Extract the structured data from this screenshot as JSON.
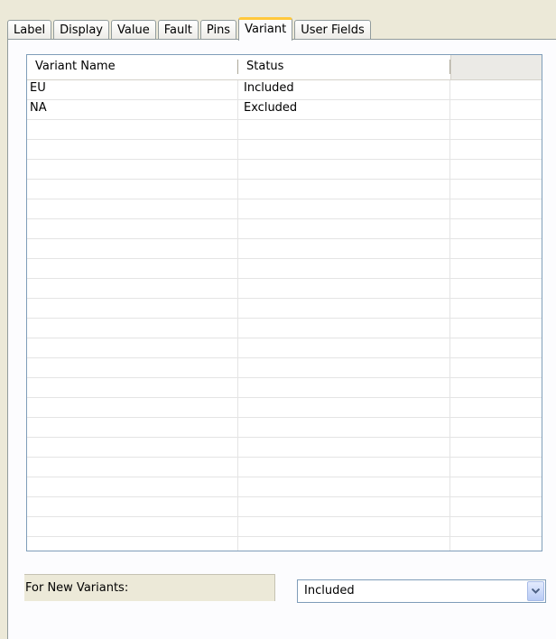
{
  "tabs": [
    {
      "label": "Label",
      "active": false
    },
    {
      "label": "Display",
      "active": false
    },
    {
      "label": "Value",
      "active": false
    },
    {
      "label": "Fault",
      "active": false
    },
    {
      "label": "Pins",
      "active": false
    },
    {
      "label": "Variant",
      "active": true
    },
    {
      "label": "User Fields",
      "active": false
    }
  ],
  "grid": {
    "columns": [
      "Variant Name",
      "Status"
    ],
    "rows": [
      {
        "name": "EU",
        "status": "Included"
      },
      {
        "name": "NA",
        "status": "Excluded"
      }
    ]
  },
  "for_new_variants": {
    "label": "For New Variants:",
    "selected": "Included"
  },
  "icons": {
    "dropdown": "chevron-down-icon"
  },
  "colors": {
    "active_tab_accent": "#ffc83c",
    "control_border": "#7f9db9",
    "window_bg": "#ece9d8"
  }
}
